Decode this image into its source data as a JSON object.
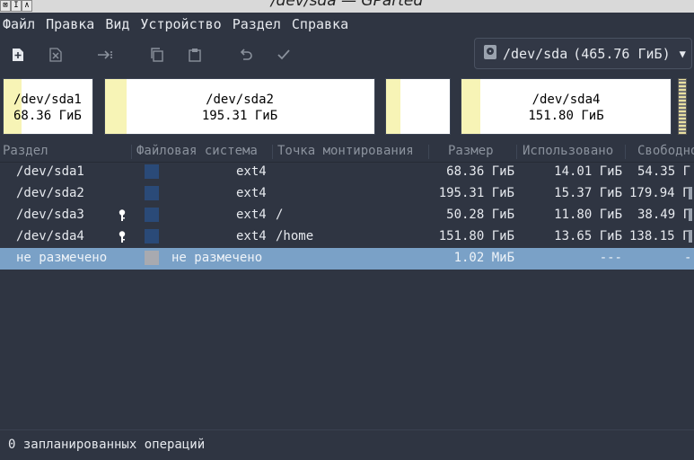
{
  "window": {
    "title": "/dev/sda — GParted"
  },
  "menubar": {
    "items": [
      "Файл",
      "Правка",
      "Вид",
      "Устройство",
      "Раздел",
      "Справка"
    ]
  },
  "device": {
    "name": "/dev/sda",
    "size": "(465.76 ГиБ)"
  },
  "diskmap": [
    {
      "name": "/dev/sda1",
      "size": "68.36 ГиБ",
      "used_fraction": 0.2
    },
    {
      "name": "/dev/sda2",
      "size": "195.31 ГиБ",
      "used_fraction": 0.08
    },
    {
      "name": "",
      "size": "",
      "used_fraction": 0.23
    },
    {
      "name": "/dev/sda4",
      "size": "151.80 ГиБ",
      "used_fraction": 0.09
    }
  ],
  "table": {
    "headers": {
      "partition": "Раздел",
      "filesystem": "Файловая система",
      "mount": "Точка монтирования",
      "size": "Размер",
      "used": "Использовано",
      "free": "Свободно"
    },
    "rows": [
      {
        "partition": "/dev/sda1",
        "fs": "ext4",
        "mount": "",
        "size": "68.36 ГиБ",
        "used": "14.01 ГиБ",
        "free": "54.35 Г",
        "locked": false,
        "fs_color": "#2a4a78",
        "selected": false
      },
      {
        "partition": "/dev/sda2",
        "fs": "ext4",
        "mount": "",
        "size": "195.31 ГиБ",
        "used": "15.37 ГиБ",
        "free": "179.94 Г",
        "locked": false,
        "fs_color": "#2a4a78",
        "selected": false
      },
      {
        "partition": "/dev/sda3",
        "fs": "ext4",
        "mount": "/",
        "size": "50.28 ГиБ",
        "used": "11.80 ГиБ",
        "free": "38.49 Г",
        "locked": true,
        "fs_color": "#2a4a78",
        "selected": false
      },
      {
        "partition": "/dev/sda4",
        "fs": "ext4",
        "mount": "/home",
        "size": "151.80 ГиБ",
        "used": "13.65 ГиБ",
        "free": "138.15 Г",
        "locked": true,
        "fs_color": "#2a4a78",
        "selected": false
      },
      {
        "partition": "не размечено",
        "fs": "не размечено",
        "mount": "",
        "size": "1.02 МиБ",
        "used": "---",
        "free": "-",
        "locked": false,
        "fs_color": "#a8aab0",
        "selected": true
      }
    ]
  },
  "status": {
    "text": "0 запланированных операций"
  },
  "icons": {
    "new": "new-partition-icon",
    "delete": "delete-icon",
    "resize": "resize-move-icon",
    "copy": "copy-icon",
    "paste": "paste-icon",
    "undo": "undo-icon",
    "apply": "apply-checkmark-icon",
    "disk": "harddisk-icon",
    "lock": "key-icon"
  },
  "colors": {
    "background": "#2f3542",
    "selection": "#7aa1c7",
    "used_space": "#f7f4b6",
    "ext4": "#2a4a78"
  }
}
